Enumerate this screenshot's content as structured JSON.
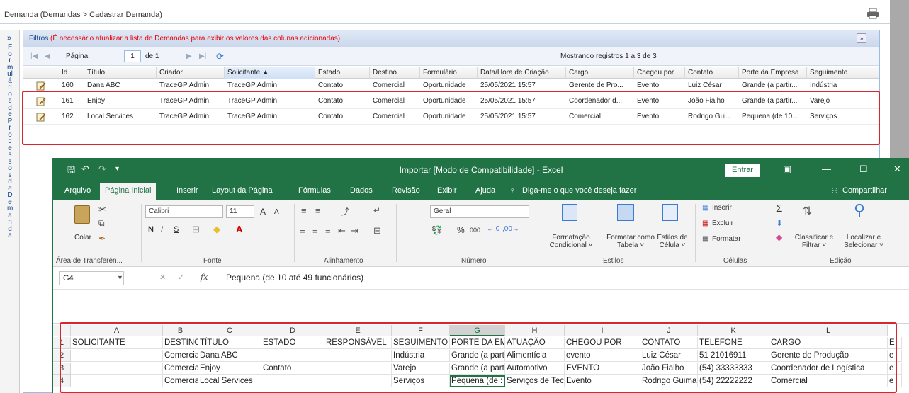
{
  "app": {
    "breadcrumb": "Demanda  (Demandas > Cadastrar Demanda)",
    "side_toggle": "»",
    "side_label": "Formulários de Processos de Demanda"
  },
  "filters": {
    "title": "Filtros",
    "warning": "(É necessário atualizar a lista de Demandas para exibir os valores das colunas adicionadas)"
  },
  "pager": {
    "page_label": "Página",
    "page_value": "1",
    "of_label": "de 1",
    "records": "Mostrando registros 1 a 3 de 3"
  },
  "grid": {
    "columns": [
      "Id",
      "Título",
      "Criador",
      "Solicitante ▲",
      "Estado",
      "Destino",
      "Formulário",
      "Data/Hora de Criação",
      "Cargo",
      "Chegou por",
      "Contato",
      "Porte da Empresa",
      "Seguimento"
    ],
    "rows": [
      [
        "160",
        "Dana ABC",
        "TraceGP Admin",
        "TraceGP Admin",
        "Contato",
        "Comercial",
        "Oportunidade",
        "25/05/2021 15:57",
        "Gerente de Pro...",
        "Evento",
        "Luiz César",
        "Grande (a partir...",
        "Indústria"
      ],
      [
        "161",
        "Enjoy",
        "TraceGP Admin",
        "TraceGP Admin",
        "Contato",
        "Comercial",
        "Oportunidade",
        "25/05/2021 15:57",
        "Coordenador d...",
        "Evento",
        "João Fialho",
        "Grande (a partir...",
        "Varejo"
      ],
      [
        "162",
        "Local Services",
        "TraceGP Admin",
        "TraceGP Admin",
        "Contato",
        "Comercial",
        "Oportunidade",
        "25/05/2021 15:57",
        "Comercial",
        "Evento",
        "Rodrigo Gui...",
        "Pequena (de 10...",
        "Serviços"
      ]
    ]
  },
  "excel": {
    "title": "Importar  [Modo de Compatibilidade]  -  Excel",
    "signin": "Entrar",
    "tabs": [
      "Arquivo",
      "Página Inicial",
      "Inserir",
      "Layout da Página",
      "Fórmulas",
      "Dados",
      "Revisão",
      "Exibir",
      "Ajuda"
    ],
    "tellme": "Diga-me o que você deseja fazer",
    "share": "Compartilhar",
    "ribbon": {
      "paste": "Colar",
      "font": "Calibri",
      "size": "11",
      "bold": "N",
      "italic": "I",
      "underline": "S",
      "number_format": "Geral",
      "percent": "%",
      "thousands": "000",
      "cond_format": "Formatação Condicional ˅",
      "format_table": "Formatar como Tabela ˅",
      "cell_styles": "Estilos de Célula ˅",
      "insert": "Inserir",
      "delete": "Excluir",
      "format": "Formatar",
      "sort_filter": "Classificar e Filtrar ˅",
      "find_select": "Localizar e Selecionar ˅",
      "groups": [
        "Área de Transferên...",
        "Fonte",
        "Alinhamento",
        "Número",
        "Estilos",
        "Células",
        "Edição"
      ]
    },
    "namebox": "G4",
    "formula": "Pequena (de 10 até 49 funcionários)",
    "col_letters": [
      "A",
      "B",
      "C",
      "D",
      "E",
      "F",
      "G",
      "H",
      "I",
      "J",
      "K",
      "L"
    ],
    "row_numbers": [
      "1",
      "2",
      "3",
      "4"
    ],
    "sheet": [
      [
        "SOLICITANTE",
        "DESTINO",
        "TÍTULO",
        "ESTADO",
        "RESPONSÁVEL",
        "SEGUIMENTO",
        "PORTE DA EMI",
        "ATUAÇÃO",
        "CHEGOU POR",
        "CONTATO",
        "TELEFONE",
        "CARGO",
        "E"
      ],
      [
        "",
        "Comercial",
        "Dana ABC",
        "",
        "",
        "Indústria",
        "Grande (a part",
        "Alimentícia",
        "evento",
        "Luiz César",
        "51 21016911",
        "Gerente de Produção",
        "e"
      ],
      [
        "",
        "Comercial",
        "Enjoy",
        "Contato",
        "",
        "Varejo",
        "Grande (a part",
        "Automotivo",
        "EVENTO",
        "João Fialho",
        "(54) 33333333",
        "Coordenador de Logística",
        "e"
      ],
      [
        "",
        "Comercial",
        "Local Services",
        "",
        "",
        "Serviços",
        "Pequena (de :",
        "Serviços de Tecno",
        "Evento",
        "Rodrigo Guima",
        "(54) 22222222",
        "Comercial",
        "e"
      ]
    ]
  },
  "colors": {
    "excel_green": "#217346",
    "highlight_red": "#d7262d",
    "ext_blue": "#15428b"
  }
}
